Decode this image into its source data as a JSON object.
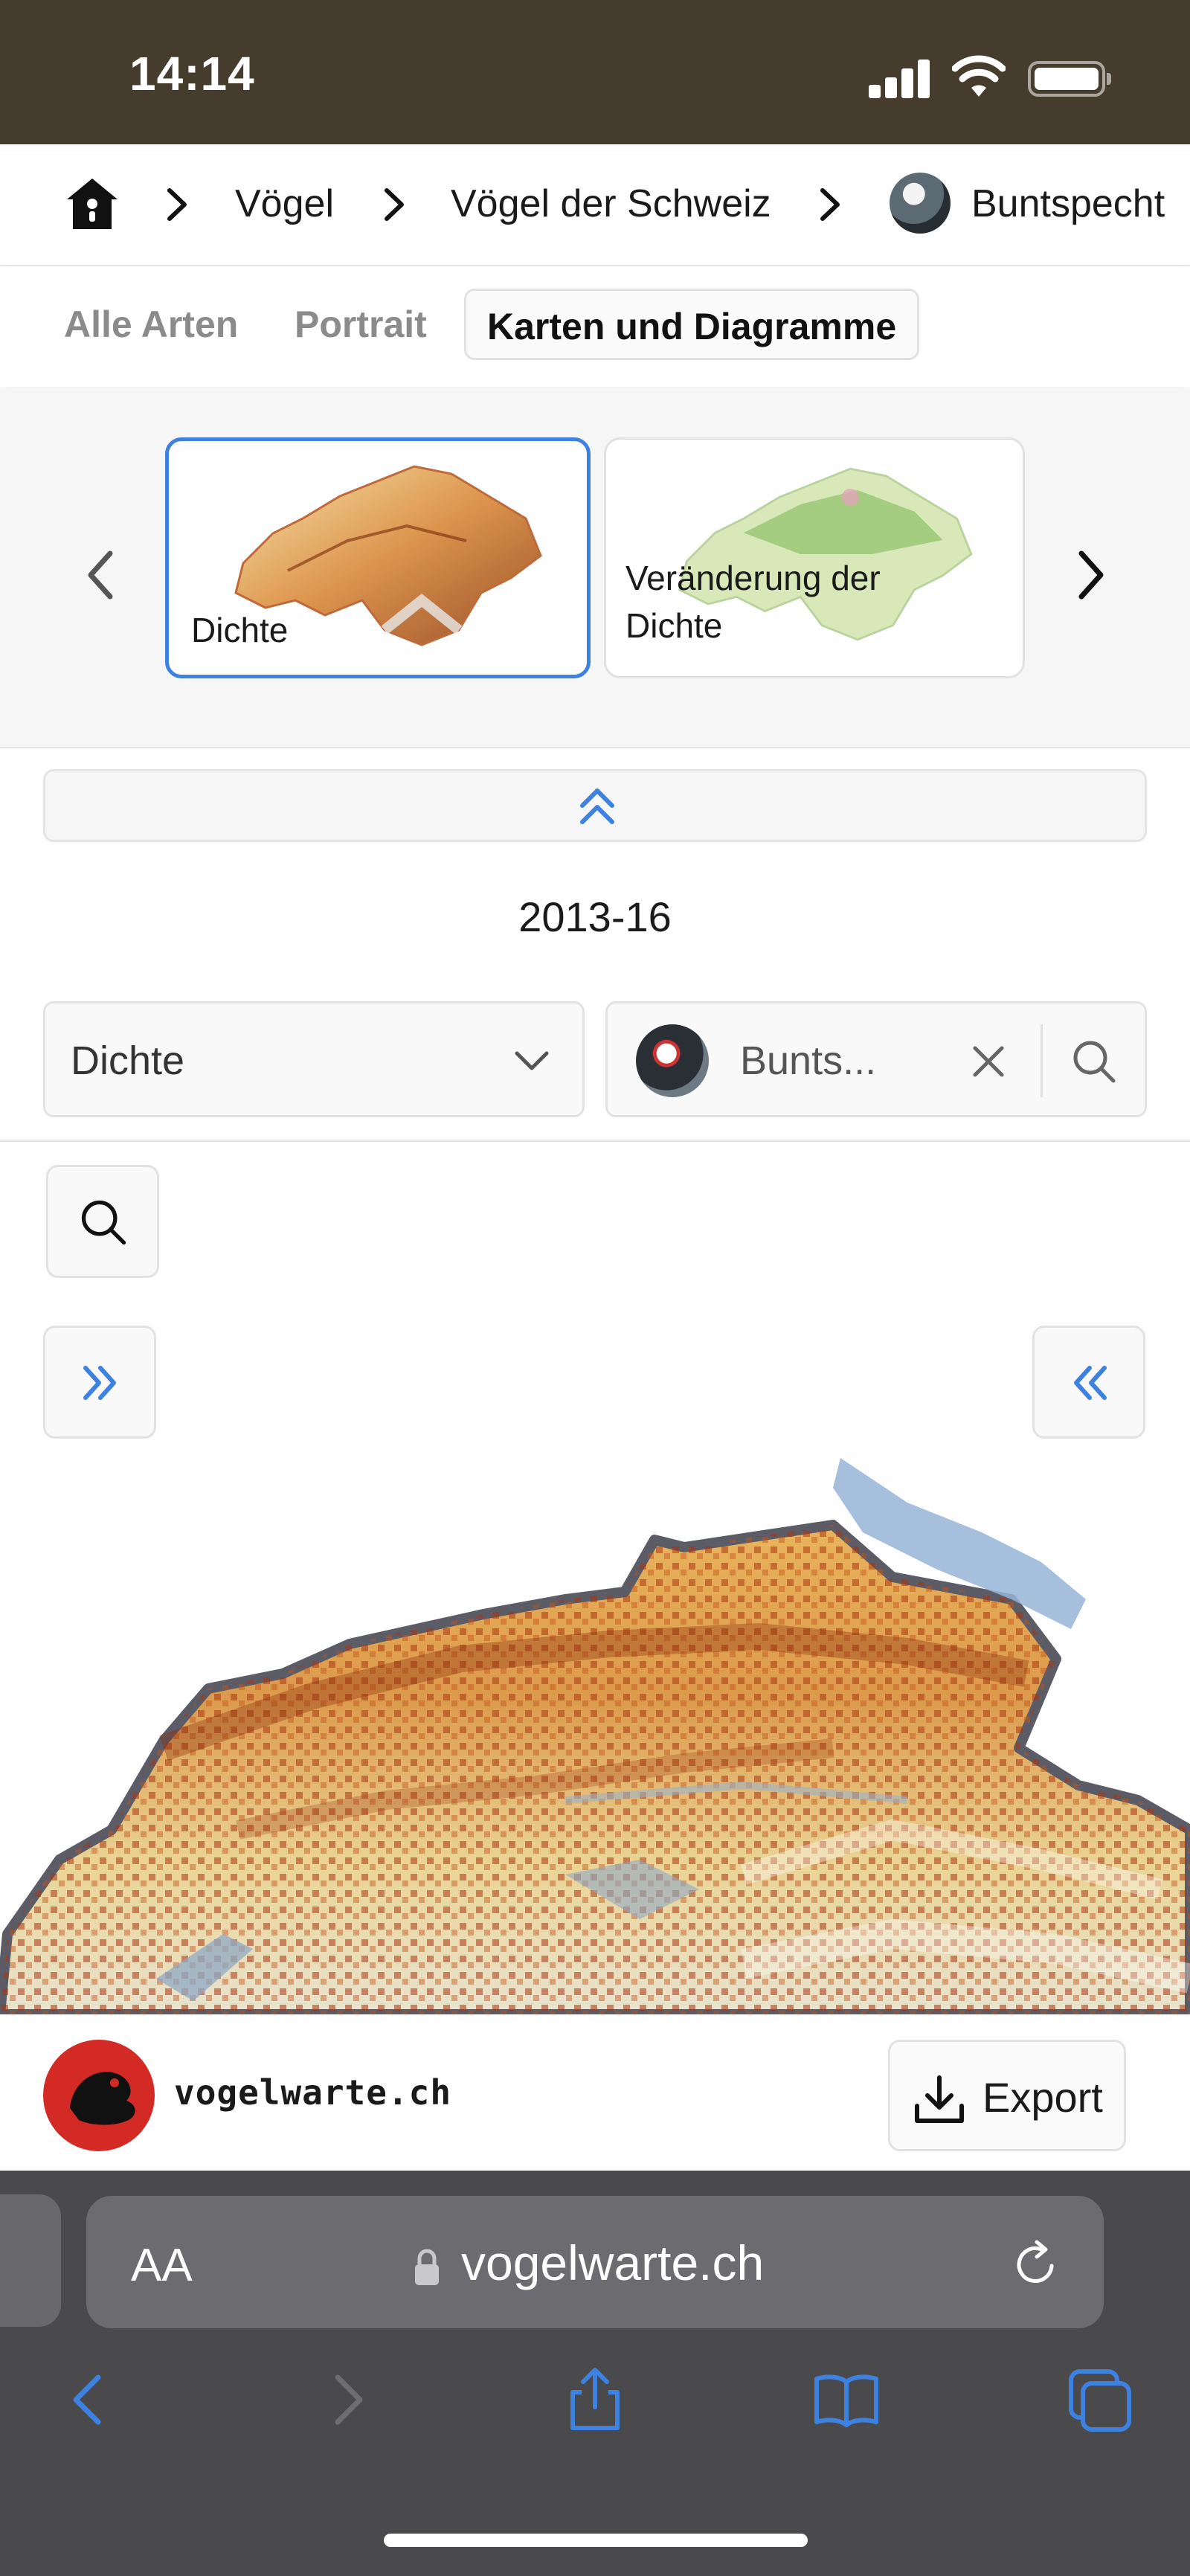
{
  "status_bar": {
    "time": "14:14"
  },
  "breadcrumb": {
    "items": [
      "Vögel",
      "Vögel der Schweiz",
      "Buntspecht"
    ]
  },
  "tabs": [
    {
      "label": "Alle Arten",
      "active": false
    },
    {
      "label": "Portrait",
      "active": false
    },
    {
      "label": "Karten und Diagramme",
      "active": true
    }
  ],
  "carousel": {
    "cards": [
      {
        "label": "Dichte",
        "selected": true
      },
      {
        "label": "Veränderung der Dichte",
        "selected": false
      }
    ]
  },
  "period": "2013-16",
  "controls": {
    "metric_select": {
      "value": "Dichte"
    },
    "species_search": {
      "value": "Bunts..."
    }
  },
  "footer": {
    "brand": "vogelwarte.ch",
    "export_label": "Export"
  },
  "browser": {
    "text_size_label": "AA",
    "url": "vogelwarte.ch"
  },
  "colors": {
    "status_bar_bg": "#453c2d",
    "accent_blue": "#3d82e0",
    "brand_red": "#d32a25",
    "safari_toolbar": "#4a4a4d"
  },
  "icons": [
    "home-icon",
    "chevron-right-icon",
    "chevron-left-icon",
    "double-chevron-up-icon",
    "chevron-down-icon",
    "close-icon",
    "search-icon",
    "double-chevron-right-icon",
    "double-chevron-left-icon",
    "download-icon",
    "lock-icon",
    "reload-icon",
    "share-icon",
    "bookmarks-icon",
    "tabs-icon"
  ]
}
